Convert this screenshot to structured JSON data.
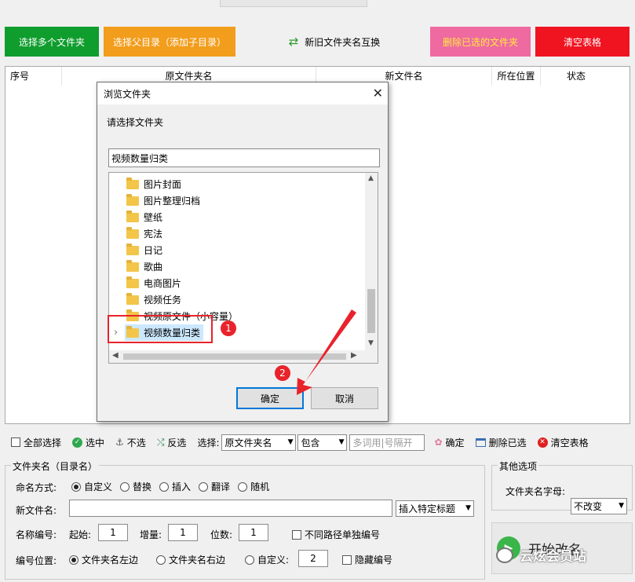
{
  "toolbar_top": {
    "select_multi": "选择多个文件夹",
    "select_parent": "选择父目录（添加子目录）",
    "swap_names": "新旧文件夹名互换",
    "delete_selected": "删除已选的文件夹",
    "clear_table": "清空表格"
  },
  "table": {
    "headers": [
      "序号",
      "原文件夹名",
      "新文件名",
      "所在位置",
      "状态"
    ]
  },
  "dialog": {
    "title": "浏览文件夹",
    "prompt": "请选择文件夹",
    "path_value": "视频数量归类",
    "folders": [
      "图片封面",
      "图片整理归档",
      "壁纸",
      "宪法",
      "日记",
      "歌曲",
      "电商图片",
      "视频任务",
      "视频原文件（小容量）",
      "视频数量归类"
    ],
    "selected_index": 9,
    "ok": "确定",
    "cancel": "取消"
  },
  "annotations": {
    "step1": "1",
    "step2": "2",
    "accent": "#e8232b"
  },
  "bottom_toolbar": {
    "select_all": "全部选择",
    "select": "选中",
    "unselect": "不选",
    "invert": "反选",
    "select_label": "选择:",
    "field_value": "原文件夹名",
    "match_value": "包含",
    "keyword_placeholder": "多词用|号隔开",
    "confirm": "确定",
    "delete_selected": "删除已选",
    "clear_table": "清空表格"
  },
  "naming": {
    "group_title": "文件夹名（目录名）",
    "mode_label": "命名方式:",
    "modes": [
      "自定义",
      "替换",
      "插入",
      "翻译",
      "随机"
    ],
    "mode_selected": 0,
    "new_name_label": "新文件名:",
    "new_name_value": "",
    "insert_title": "插入特定标题",
    "number_label": "名称编号:",
    "start_label": "起始:",
    "start_value": "1",
    "step_label": "增量:",
    "step_value": "1",
    "digits_label": "位数:",
    "digits_value": "1",
    "separate_numbering": "不同路径单独编号",
    "position_label": "编号位置:",
    "positions": [
      "文件夹名左边",
      "文件夹名右边",
      "自定义:"
    ],
    "position_selected": 0,
    "custom_value": "2",
    "hide_number": "隐藏编号"
  },
  "other": {
    "group_title": "其他选项",
    "case_label": "文件夹名字母:",
    "case_value": "不改变",
    "start_button": "开始改名"
  },
  "watermark": "云炫会员站"
}
